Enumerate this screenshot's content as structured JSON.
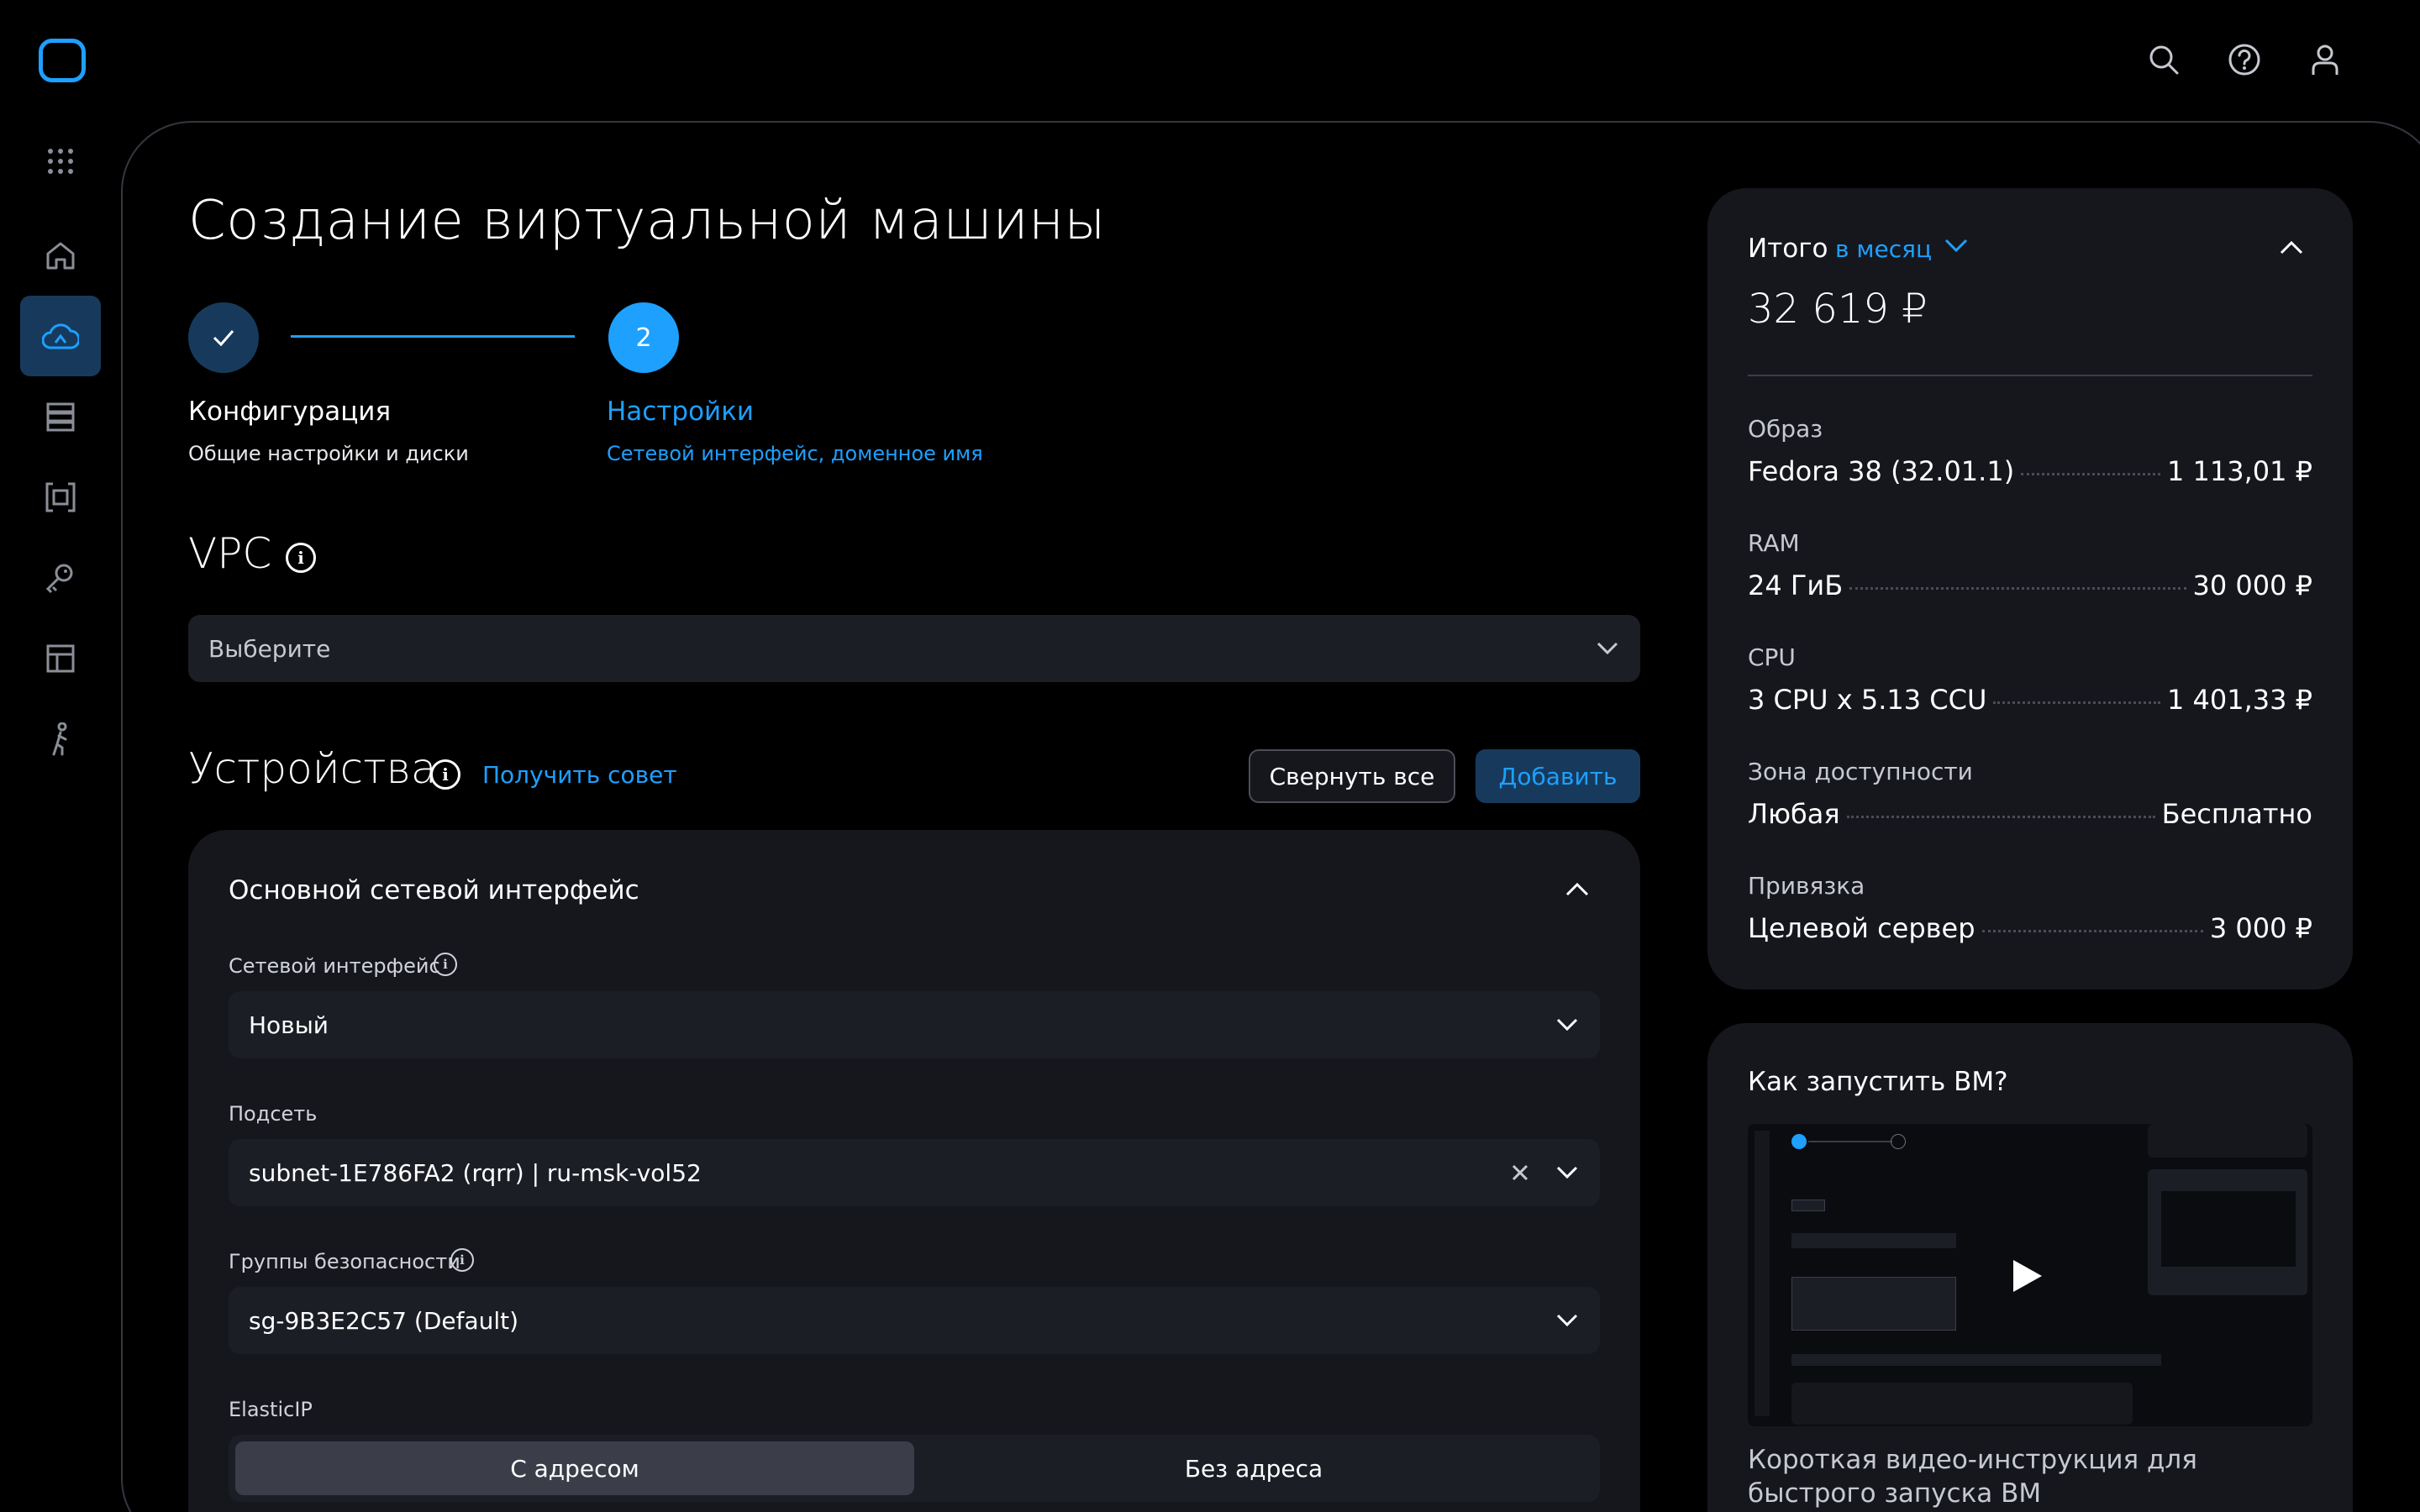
{
  "header": {
    "logo_icon": "app-logo-rounded-square",
    "icons": [
      "search-icon",
      "help-icon",
      "user-icon"
    ]
  },
  "sidebar": {
    "items": [
      {
        "icon": "apps-grid-icon"
      },
      {
        "icon": "home-icon"
      },
      {
        "icon": "cloud-icon",
        "active": true
      },
      {
        "icon": "server-list-icon"
      },
      {
        "icon": "container-icon"
      },
      {
        "icon": "key-icon"
      },
      {
        "icon": "layout-icon"
      },
      {
        "icon": "person-walk-icon"
      }
    ]
  },
  "page": {
    "title": "Создание виртуальной машины"
  },
  "stepper": {
    "steps": [
      {
        "number": "",
        "title": "Конфигурация",
        "subtitle": "Общие настройки и диски",
        "state": "done"
      },
      {
        "number": "2",
        "title": "Настройки",
        "subtitle": "Сетевой интерфейс, доменное имя",
        "state": "current"
      }
    ]
  },
  "vpc": {
    "heading": "VPC",
    "placeholder": "Выберите"
  },
  "devices": {
    "heading": "Устройства",
    "advice_link": "Получить совет",
    "collapse_all": "Свернуть все",
    "add": "Добавить",
    "card": {
      "title": "Основной сетевой интерфейс",
      "network_interface": {
        "label": "Сетевой интерфейс",
        "value": "Новый"
      },
      "subnet": {
        "label": "Подсеть",
        "value": "subnet-1E786FA2 (rqrr) | ru-msk-vol52"
      },
      "security_groups": {
        "label": "Группы безопасности",
        "value": "sg-9B3E2C57 (Default)"
      },
      "elastic_ip": {
        "label": "ElasticIP",
        "options": [
          "С адресом",
          "Без адреса"
        ],
        "selected": "С адресом"
      }
    }
  },
  "summary": {
    "label": "Итого",
    "period": "в месяц",
    "total": "32 619 ₽",
    "rows": [
      {
        "label": "Образ",
        "name": "Fedora 38 (32.01.1)",
        "price": "1 113,01 ₽"
      },
      {
        "label": "RAM",
        "name": "24 ГиБ",
        "price": "30 000 ₽"
      },
      {
        "label": "CPU",
        "name": "3 CPU x 5.13 CCU",
        "price": "1 401,33 ₽"
      },
      {
        "label": "Зона доступности",
        "name": "Любая",
        "price": "Бесплатно"
      },
      {
        "label": "Привязка",
        "name": "Целевой сервер",
        "price": "3 000 ₽"
      }
    ]
  },
  "howto": {
    "title": "Как запустить ВМ?",
    "caption": "Короткая видео-инструкция для быстрого запуска ВМ"
  },
  "colors": {
    "accent": "#1ea0ff",
    "accent_dark": "#173a5c",
    "surface": "#15171d",
    "input": "#1c1e26"
  }
}
